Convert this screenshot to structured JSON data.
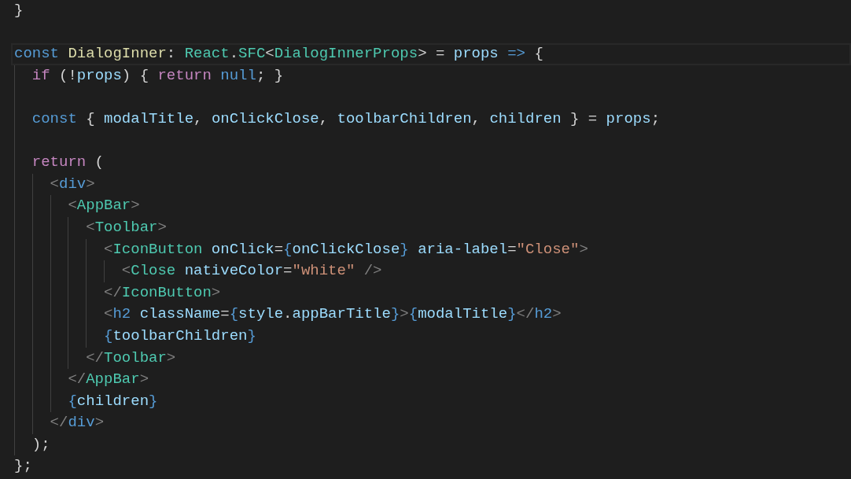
{
  "editor": {
    "lines": [
      {
        "current": false,
        "tokens": [
          {
            "kind": "punct",
            "text": "}"
          }
        ]
      },
      {
        "current": false
      },
      {
        "current": true,
        "tokens": [
          {
            "kind": "kw",
            "text": "const "
          },
          {
            "kind": "fn",
            "text": "DialogInner"
          },
          {
            "kind": "punct",
            "text": ": "
          },
          {
            "kind": "type",
            "text": "React"
          },
          {
            "kind": "punct",
            "text": "."
          },
          {
            "kind": "type",
            "text": "SFC"
          },
          {
            "kind": "punct",
            "text": "<"
          },
          {
            "kind": "type",
            "text": "DialogInnerProps"
          },
          {
            "kind": "punct",
            "text": "> = "
          },
          {
            "kind": "var",
            "text": "props "
          },
          {
            "kind": "kw",
            "text": "=>"
          },
          {
            "kind": "punct",
            "text": " {"
          }
        ]
      },
      {
        "current": false,
        "tokens": [
          {
            "kind": "ctl",
            "text": "  if"
          },
          {
            "kind": "punct",
            "text": " (!"
          },
          {
            "kind": "var",
            "text": "props"
          },
          {
            "kind": "punct",
            "text": ") { "
          },
          {
            "kind": "ctl",
            "text": "return "
          },
          {
            "kind": "kw",
            "text": "null"
          },
          {
            "kind": "punct",
            "text": "; }"
          }
        ]
      },
      {
        "current": false
      },
      {
        "current": false,
        "tokens": [
          {
            "kind": "kw",
            "text": "  const"
          },
          {
            "kind": "punct",
            "text": " { "
          },
          {
            "kind": "var",
            "text": "modalTitle"
          },
          {
            "kind": "punct",
            "text": ", "
          },
          {
            "kind": "var",
            "text": "onClickClose"
          },
          {
            "kind": "punct",
            "text": ", "
          },
          {
            "kind": "var",
            "text": "toolbarChildren"
          },
          {
            "kind": "punct",
            "text": ", "
          },
          {
            "kind": "var",
            "text": "children"
          },
          {
            "kind": "punct",
            "text": " } = "
          },
          {
            "kind": "var",
            "text": "props"
          },
          {
            "kind": "punct",
            "text": ";"
          }
        ]
      },
      {
        "current": false
      },
      {
        "current": false,
        "tokens": [
          {
            "kind": "ctl",
            "text": "  return"
          },
          {
            "kind": "punct",
            "text": " ("
          }
        ]
      },
      {
        "current": false,
        "tokens": [
          {
            "kind": "tagp",
            "text": "    <"
          },
          {
            "kind": "html",
            "text": "div"
          },
          {
            "kind": "tagp",
            "text": ">"
          }
        ]
      },
      {
        "current": false,
        "tokens": [
          {
            "kind": "tagp",
            "text": "      <"
          },
          {
            "kind": "tag",
            "text": "AppBar"
          },
          {
            "kind": "tagp",
            "text": ">"
          }
        ]
      },
      {
        "current": false,
        "tokens": [
          {
            "kind": "tagp",
            "text": "        <"
          },
          {
            "kind": "tag",
            "text": "Toolbar"
          },
          {
            "kind": "tagp",
            "text": ">"
          }
        ]
      },
      {
        "current": false,
        "tokens": [
          {
            "kind": "tagp",
            "text": "          <"
          },
          {
            "kind": "tag",
            "text": "IconButton "
          },
          {
            "kind": "attr",
            "text": "onClick"
          },
          {
            "kind": "punct",
            "text": "="
          },
          {
            "kind": "brace",
            "text": "{"
          },
          {
            "kind": "var",
            "text": "onClickClose"
          },
          {
            "kind": "brace",
            "text": "} "
          },
          {
            "kind": "attr",
            "text": "aria-label"
          },
          {
            "kind": "punct",
            "text": "="
          },
          {
            "kind": "str",
            "text": "\"Close\""
          },
          {
            "kind": "tagp",
            "text": ">"
          }
        ]
      },
      {
        "current": false,
        "tokens": [
          {
            "kind": "tagp",
            "text": "            <"
          },
          {
            "kind": "tag",
            "text": "Close "
          },
          {
            "kind": "attr",
            "text": "nativeColor"
          },
          {
            "kind": "punct",
            "text": "="
          },
          {
            "kind": "str",
            "text": "\"white\""
          },
          {
            "kind": "tagp",
            "text": " />"
          }
        ]
      },
      {
        "current": false,
        "tokens": [
          {
            "kind": "tagp",
            "text": "          </"
          },
          {
            "kind": "tag",
            "text": "IconButton"
          },
          {
            "kind": "tagp",
            "text": ">"
          }
        ]
      },
      {
        "current": false,
        "tokens": [
          {
            "kind": "tagp",
            "text": "          <"
          },
          {
            "kind": "html",
            "text": "h2 "
          },
          {
            "kind": "attr",
            "text": "className"
          },
          {
            "kind": "punct",
            "text": "="
          },
          {
            "kind": "brace",
            "text": "{"
          },
          {
            "kind": "var",
            "text": "style"
          },
          {
            "kind": "punct",
            "text": "."
          },
          {
            "kind": "var",
            "text": "appBarTitle"
          },
          {
            "kind": "brace",
            "text": "}"
          },
          {
            "kind": "tagp",
            "text": ">"
          },
          {
            "kind": "brace",
            "text": "{"
          },
          {
            "kind": "var",
            "text": "modalTitle"
          },
          {
            "kind": "brace",
            "text": "}"
          },
          {
            "kind": "tagp",
            "text": "</"
          },
          {
            "kind": "html",
            "text": "h2"
          },
          {
            "kind": "tagp",
            "text": ">"
          }
        ]
      },
      {
        "current": false,
        "tokens": [
          {
            "kind": "brace",
            "text": "          {"
          },
          {
            "kind": "var",
            "text": "toolbarChildren"
          },
          {
            "kind": "brace",
            "text": "}"
          }
        ]
      },
      {
        "current": false,
        "tokens": [
          {
            "kind": "tagp",
            "text": "        </"
          },
          {
            "kind": "tag",
            "text": "Toolbar"
          },
          {
            "kind": "tagp",
            "text": ">"
          }
        ]
      },
      {
        "current": false,
        "tokens": [
          {
            "kind": "tagp",
            "text": "      </"
          },
          {
            "kind": "tag",
            "text": "AppBar"
          },
          {
            "kind": "tagp",
            "text": ">"
          }
        ]
      },
      {
        "current": false,
        "tokens": [
          {
            "kind": "brace",
            "text": "      {"
          },
          {
            "kind": "var",
            "text": "children"
          },
          {
            "kind": "brace",
            "text": "}"
          }
        ]
      },
      {
        "current": false,
        "tokens": [
          {
            "kind": "tagp",
            "text": "    </"
          },
          {
            "kind": "html",
            "text": "div"
          },
          {
            "kind": "tagp",
            "text": ">"
          }
        ]
      },
      {
        "current": false,
        "tokens": [
          {
            "kind": "punct",
            "text": "  );"
          }
        ]
      },
      {
        "current": false,
        "tokens": [
          {
            "kind": "punct",
            "text": "};"
          }
        ]
      }
    ]
  }
}
